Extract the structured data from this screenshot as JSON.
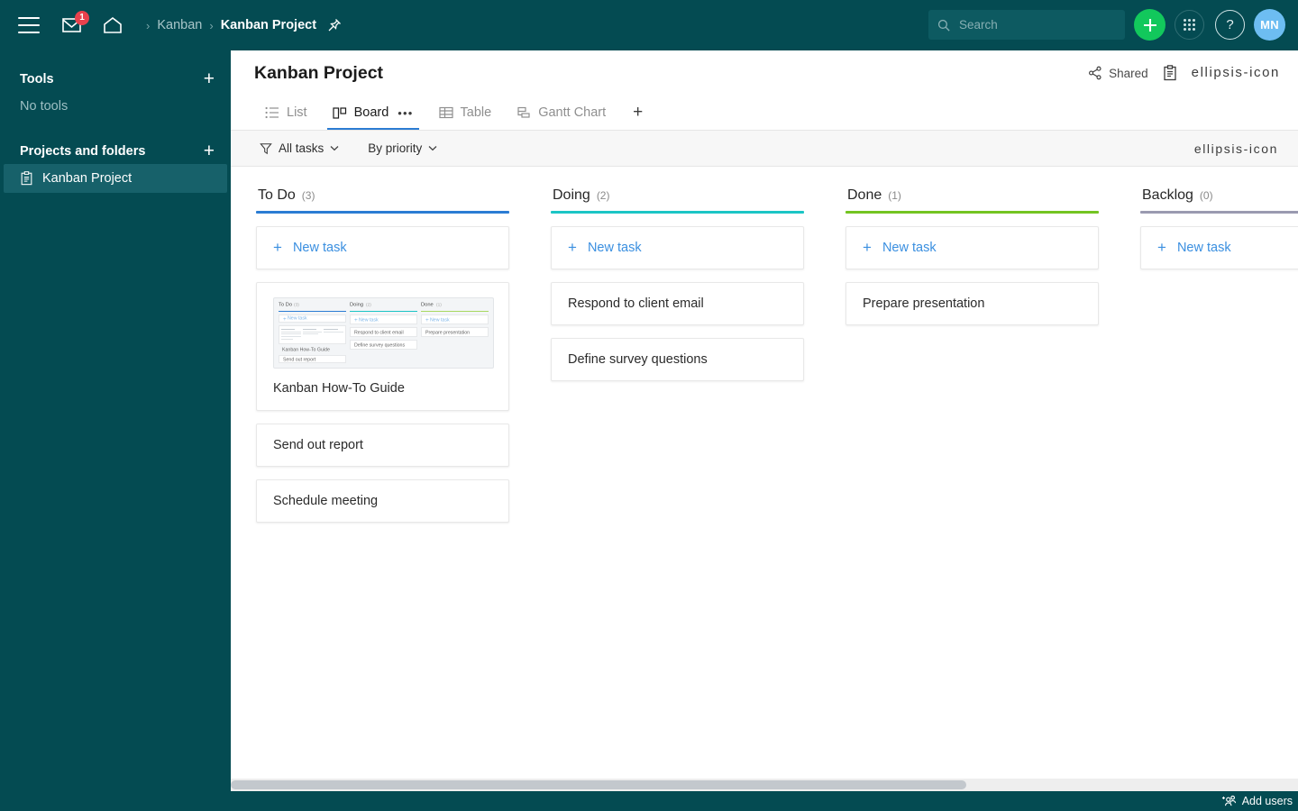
{
  "topbar": {
    "menu_icon": "hamburger-menu-icon",
    "mail_icon": "mail-icon",
    "mail_badge": "1",
    "home_icon": "home-icon",
    "breadcrumb": {
      "separator": "›",
      "parent": "Kanban",
      "current": "Kanban Project",
      "pin_icon": "pin-icon"
    },
    "search": {
      "placeholder": "Search",
      "value": "",
      "icon": "search-icon"
    },
    "create_icon": "plus-icon",
    "apps_icon": "grid-apps-icon",
    "help_icon": "question-mark-icon",
    "avatar_initials": "MN"
  },
  "sidebar": {
    "tools": {
      "label": "Tools",
      "add_icon": "plus-icon",
      "empty_text": "No tools"
    },
    "projects": {
      "label": "Projects and folders",
      "add_icon": "plus-icon"
    },
    "items": [
      {
        "label": "Kanban Project",
        "icon": "clipboard-icon",
        "active": true
      }
    ]
  },
  "header": {
    "title": "Kanban Project",
    "shared_label": "Shared",
    "shared_icon": "share-nodes-icon",
    "clipboard_icon": "clipboard-icon",
    "more_icon": "ellipsis-icon"
  },
  "tabs": [
    {
      "label": "List",
      "icon": "list-icon",
      "active": false
    },
    {
      "label": "Board",
      "icon": "board-icon",
      "active": true,
      "dots": "•••"
    },
    {
      "label": "Table",
      "icon": "table-icon",
      "active": false
    },
    {
      "label": "Gantt Chart",
      "icon": "gantt-icon",
      "active": false
    }
  ],
  "tabs_add_icon": "plus-icon",
  "filterbar": {
    "filter_icon": "funnel-icon",
    "filter_label": "All tasks",
    "group_label": "By priority",
    "caret": "⌄",
    "more_icon": "ellipsis-icon"
  },
  "board": {
    "new_task_label": "New task",
    "new_task_icon": "plus-icon",
    "columns": [
      {
        "name": "To Do",
        "count": "(3)",
        "color": "#2b7cd3",
        "tasks": [
          {
            "title": "Kanban How-To Guide",
            "has_thumbnail": true
          },
          {
            "title": "Send out report",
            "has_thumbnail": false
          },
          {
            "title": "Schedule meeting",
            "has_thumbnail": false
          }
        ]
      },
      {
        "name": "Doing",
        "count": "(2)",
        "color": "#1bc5c5",
        "tasks": [
          {
            "title": "Respond to client email",
            "has_thumbnail": false
          },
          {
            "title": "Define survey questions",
            "has_thumbnail": false
          }
        ]
      },
      {
        "name": "Done",
        "count": "(1)",
        "color": "#74c422",
        "tasks": [
          {
            "title": "Prepare presentation",
            "has_thumbnail": false
          }
        ]
      },
      {
        "name": "Backlog",
        "count": "(0)",
        "color": "#9a9ab0",
        "tasks": []
      }
    ]
  },
  "thumbnail_preview": {
    "columns": [
      {
        "name": "To Do",
        "count": "(3)",
        "color": "#2b7cd3",
        "new_task": "New task",
        "tasks": [
          "Kanban How-To Guide",
          "Send out report"
        ]
      },
      {
        "name": "Doing",
        "count": "(2)",
        "color": "#1bc5c5",
        "new_task": "New task",
        "tasks": [
          "Respond to client email",
          "Define survey questions"
        ]
      },
      {
        "name": "Done",
        "count": "(1)",
        "color": "#74c422",
        "new_task": "New task",
        "tasks": [
          "Prepare presentation"
        ]
      }
    ]
  },
  "bottombar": {
    "add_users_label": "Add users",
    "add_users_icon": "add-users-icon"
  }
}
